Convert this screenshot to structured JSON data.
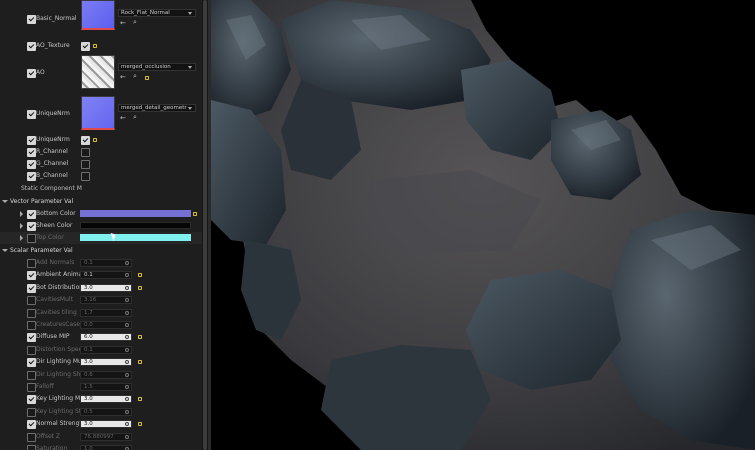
{
  "textures": {
    "basic_normal": {
      "label": "Basic_Normal",
      "value": "Rock_Flat_Normal"
    },
    "ao_texture": {
      "label": "AO_Texture"
    },
    "ao": {
      "label": "AO",
      "value": "merged_occlusion"
    },
    "unique_nrm": {
      "label": "UniqueNrm",
      "value": "merged_detail_geometr"
    }
  },
  "switches": [
    {
      "label": "UniqueNrm",
      "checked": true
    },
    {
      "label": "R_Channel",
      "checked": false
    },
    {
      "label": "G_Channel",
      "checked": false
    },
    {
      "label": "B_Channel",
      "checked": false
    }
  ],
  "static_component_label": "Static Component M",
  "vector_header": "Vector Parameter Val",
  "vectors": [
    {
      "label": "Bottom Color",
      "color": "#7670d4",
      "enabled": true
    },
    {
      "label": "Sheen Color",
      "color": "#050505",
      "enabled": true
    },
    {
      "label": "Top Color",
      "color": "#7ff0ee",
      "enabled": false
    }
  ],
  "scalar_header": "Scalar Parameter Val",
  "scalars": [
    {
      "label": "Add Normals",
      "value": "0.1",
      "enabled": false
    },
    {
      "label": "Ambient Animati",
      "value": "0.1",
      "enabled": true
    },
    {
      "label": "Bot Distribution",
      "value": "3.0",
      "enabled": true,
      "active": true
    },
    {
      "label": "CavitiesMult",
      "value": "3.16",
      "enabled": false
    },
    {
      "label": "Cavities tiling",
      "value": "1.7",
      "enabled": false
    },
    {
      "label": "CreaturesCase",
      "value": "0.0",
      "enabled": false
    },
    {
      "label": "Diffuse MIP",
      "value": "6.0",
      "enabled": true,
      "active": true
    },
    {
      "label": "Distortion Speed",
      "value": "0.1",
      "enabled": false
    },
    {
      "label": "Dir Lighting Mul",
      "value": "3.0",
      "enabled": true,
      "active": true
    },
    {
      "label": "Dir Lighting Sha",
      "value": "0.6",
      "enabled": false
    },
    {
      "label": "Falloff",
      "value": "1.5",
      "enabled": false
    },
    {
      "label": "Key Lighting Mul",
      "value": "3.0",
      "enabled": true,
      "active": true
    },
    {
      "label": "Key Lighting Sta",
      "value": "0.5",
      "enabled": false
    },
    {
      "label": "Normal Strength",
      "value": "3.0",
      "enabled": true,
      "active": true
    },
    {
      "label": "Offset Z",
      "value": "76.880997",
      "enabled": false
    },
    {
      "label": "Saturation",
      "value": "1.0",
      "enabled": false
    }
  ],
  "icons": [
    "checkbox",
    "reset-arrow-icon",
    "browse-arrow-icon",
    "search-icon",
    "expand-arrow-icon",
    "dropdown-arrow-icon"
  ]
}
